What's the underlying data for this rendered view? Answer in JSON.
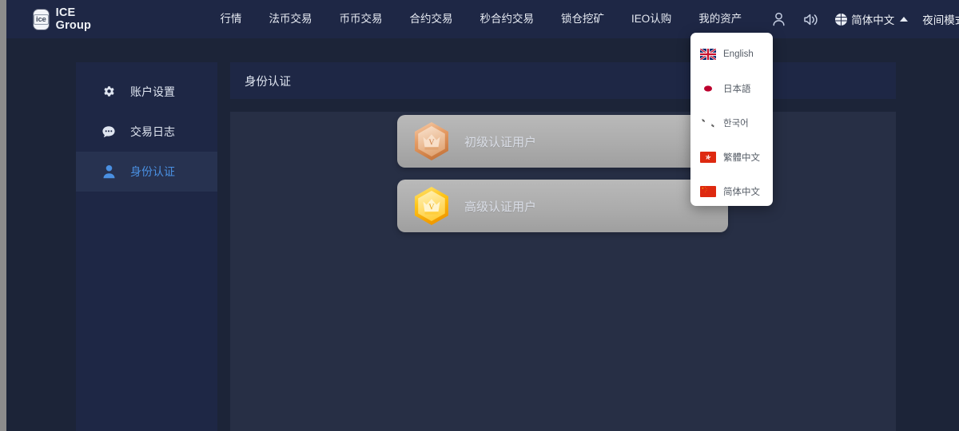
{
  "header": {
    "brand_mark_text": "ice",
    "brand_name": "ICE Group",
    "nav_items": [
      {
        "label": "行情"
      },
      {
        "label": "法币交易"
      },
      {
        "label": "币币交易"
      },
      {
        "label": "合约交易"
      },
      {
        "label": "秒合约交易"
      },
      {
        "label": "锁仓挖矿"
      },
      {
        "label": "IEO认购"
      },
      {
        "label": "我的资产"
      }
    ],
    "icons": [
      {
        "name": "user-icon"
      },
      {
        "name": "sound-icon"
      }
    ],
    "language_selector": {
      "label": "简体中文",
      "icon": "globe-icon",
      "caret": "caret-up-icon",
      "expanded": true
    },
    "night_mode": {
      "label": "夜间模式",
      "icon": "moon-icon",
      "caret": "caret-down-icon"
    }
  },
  "language_menu": {
    "items": [
      {
        "label": "English",
        "flag": "flag-uk"
      },
      {
        "label": "日本語",
        "flag": "flag-jp"
      },
      {
        "label": "한국어",
        "flag": "flag-kr"
      },
      {
        "label": "繁體中文",
        "flag": "flag-hk"
      },
      {
        "label": "简体中文",
        "flag": "flag-cn"
      }
    ]
  },
  "sidebar": {
    "items": [
      {
        "label": "账户设置",
        "icon": "gear-icon",
        "active": false
      },
      {
        "label": "交易日志",
        "icon": "chat-icon",
        "active": false
      },
      {
        "label": "身份认证",
        "icon": "person-icon",
        "active": true
      }
    ]
  },
  "main": {
    "page_title": "身份认证",
    "cards": [
      {
        "label": "初级认证用户",
        "badge": "bronze-crown-badge"
      },
      {
        "label": "高级认证用户",
        "badge": "gold-crown-badge"
      }
    ]
  },
  "colors": {
    "page_background": "#8c8c8c",
    "app_background": "#1c2438",
    "header_background": "#1e2745",
    "panel_background": "#272f45",
    "accent_active": "#4a90e2",
    "card_gray": "#acacac",
    "badge_bronze": "#e8a36a",
    "badge_gold": "#ffc519"
  }
}
